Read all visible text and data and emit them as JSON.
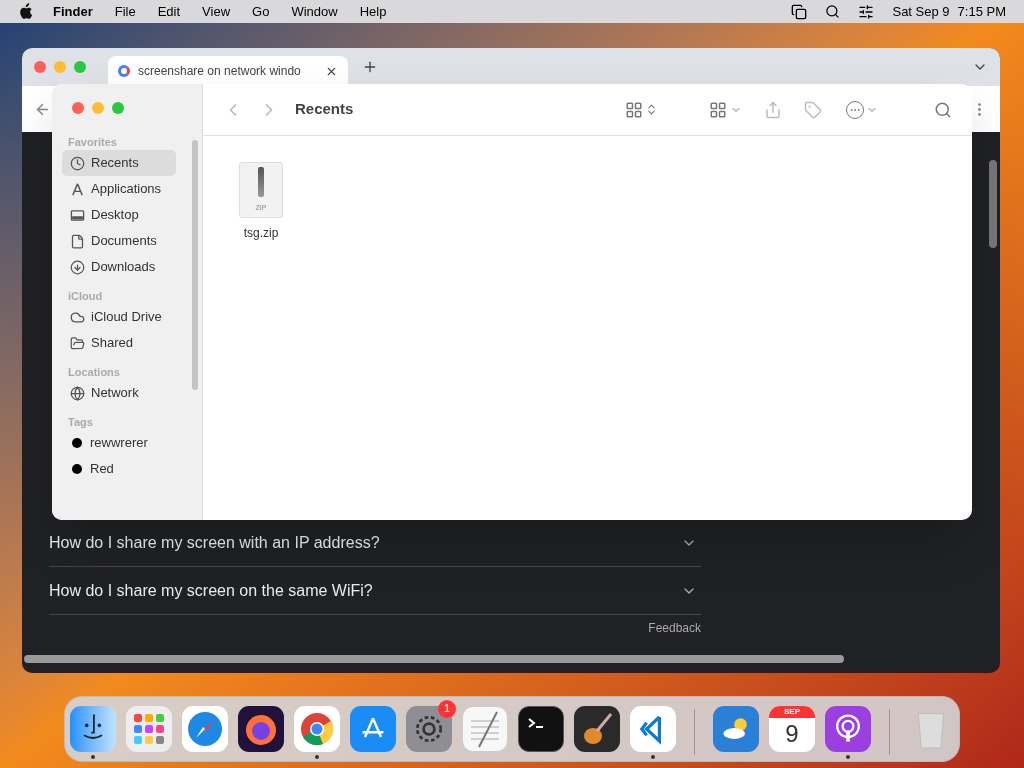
{
  "menu_bar": {
    "app": "Finder",
    "menus": [
      "File",
      "Edit",
      "View",
      "Go",
      "Window",
      "Help"
    ],
    "date": "Sat Sep 9",
    "time": "7:15 PM"
  },
  "browser": {
    "tab": {
      "title": "screenshare on network windo"
    },
    "faq": [
      {
        "question": "How do I share my screen with an IP address?",
        "expanded": false
      },
      {
        "question": "How do I share my screen on the same WiFi?",
        "expanded": false
      }
    ],
    "feedback": "Feedback"
  },
  "finder": {
    "title": "Recents",
    "sidebar": [
      {
        "heading": "Favorites",
        "items": [
          {
            "label": "Recents",
            "kind": "recents",
            "selected": true
          },
          {
            "label": "Applications",
            "kind": "applications",
            "selected": false
          },
          {
            "label": "Desktop",
            "kind": "desktop",
            "selected": false
          },
          {
            "label": "Documents",
            "kind": "documents",
            "selected": false
          },
          {
            "label": "Downloads",
            "kind": "downloads",
            "selected": false
          }
        ]
      },
      {
        "heading": "iCloud",
        "items": [
          {
            "label": "iCloud Drive",
            "kind": "cloud",
            "selected": false
          },
          {
            "label": "Shared",
            "kind": "shared",
            "selected": false
          }
        ]
      },
      {
        "heading": "Locations",
        "items": [
          {
            "label": "Network",
            "kind": "network",
            "selected": false
          }
        ]
      },
      {
        "heading": "Tags",
        "items": [
          {
            "label": "rewwrerer",
            "kind": "tag",
            "selected": false
          },
          {
            "label": "Red",
            "kind": "tag",
            "selected": false
          }
        ]
      }
    ],
    "files": [
      {
        "name": "tsg.zip",
        "icon_label": "ZIP"
      }
    ]
  },
  "dock": [
    {
      "kind": "finder",
      "running": true
    },
    {
      "kind": "launchpad",
      "running": false
    },
    {
      "kind": "safari",
      "running": false
    },
    {
      "kind": "firefox",
      "running": false
    },
    {
      "kind": "chrome",
      "running": true
    },
    {
      "kind": "appstore",
      "running": false
    },
    {
      "kind": "settings",
      "running": false,
      "badge": "1"
    },
    {
      "kind": "textedit",
      "running": false
    },
    {
      "kind": "terminal",
      "running": false
    },
    {
      "kind": "garageband",
      "running": false
    },
    {
      "kind": "vscode",
      "running": true
    },
    {
      "kind": "separator"
    },
    {
      "kind": "weather",
      "running": false
    },
    {
      "kind": "calendar",
      "running": false,
      "month": "SEP",
      "day": "9"
    },
    {
      "kind": "podcasts",
      "running": true
    },
    {
      "kind": "separator"
    },
    {
      "kind": "trash",
      "running": false
    }
  ]
}
